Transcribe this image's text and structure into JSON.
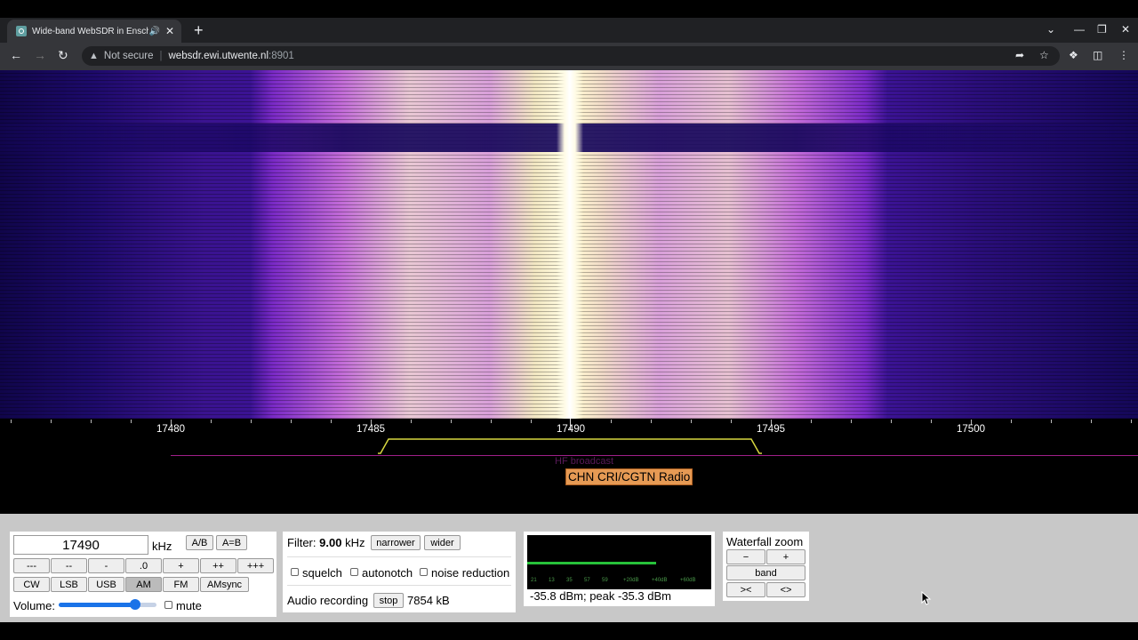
{
  "browser": {
    "tab_title": "Wide-band WebSDR in Ensch",
    "tab_audio_icon": "speaker-icon",
    "new_tab": "+",
    "security_label": "Not secure",
    "url_host": "websdr.ewi.utwente.nl",
    "url_port": ":8901"
  },
  "waterfall": {
    "ticks": [
      "17480",
      "17485",
      "17490",
      "17495",
      "17500"
    ],
    "band_label": "HF broadcast",
    "station_label": "CHN CRI/CGTN Radio"
  },
  "tuning": {
    "frequency_value": "17490",
    "unit": "kHz",
    "ab_label": "A/B",
    "aeqb_label": "A=B",
    "step_buttons": [
      "---",
      "--",
      "-",
      ".0",
      "+",
      "++",
      "+++"
    ],
    "modes": [
      "CW",
      "LSB",
      "USB",
      "AM",
      "FM",
      "AMsync"
    ],
    "selected_mode": "AM",
    "volume_label": "Volume:",
    "volume_level": 0.78,
    "mute_label": "mute"
  },
  "filter": {
    "label": "Filter:",
    "value": "9.00",
    "unit": "kHz",
    "narrower_label": "narrower",
    "wider_label": "wider",
    "squelch_label": "squelch",
    "autonotch_label": "autonotch",
    "noise_reduction_label": "noise reduction",
    "audio_recording_label": "Audio recording",
    "stop_label": "stop",
    "recording_size": "7854 kB"
  },
  "smeter": {
    "readout": "-35.8 dBm; peak  -35.3 dBm",
    "scale": [
      "S1",
      "S3",
      "S5",
      "S7",
      "S9",
      "+20dB",
      "+40dB",
      "+60dB"
    ],
    "level_fraction": 0.7
  },
  "zoom": {
    "title": "Waterfall zoom",
    "minus_label": "−",
    "plus_label": "+",
    "band_label": "band",
    "narrow_label": "><",
    "wide_label": "<>"
  },
  "colors": {
    "accent": "#1a73e8",
    "station_bg": "#e69a54",
    "passband": "#d8d840",
    "meter": "#27c23a"
  }
}
